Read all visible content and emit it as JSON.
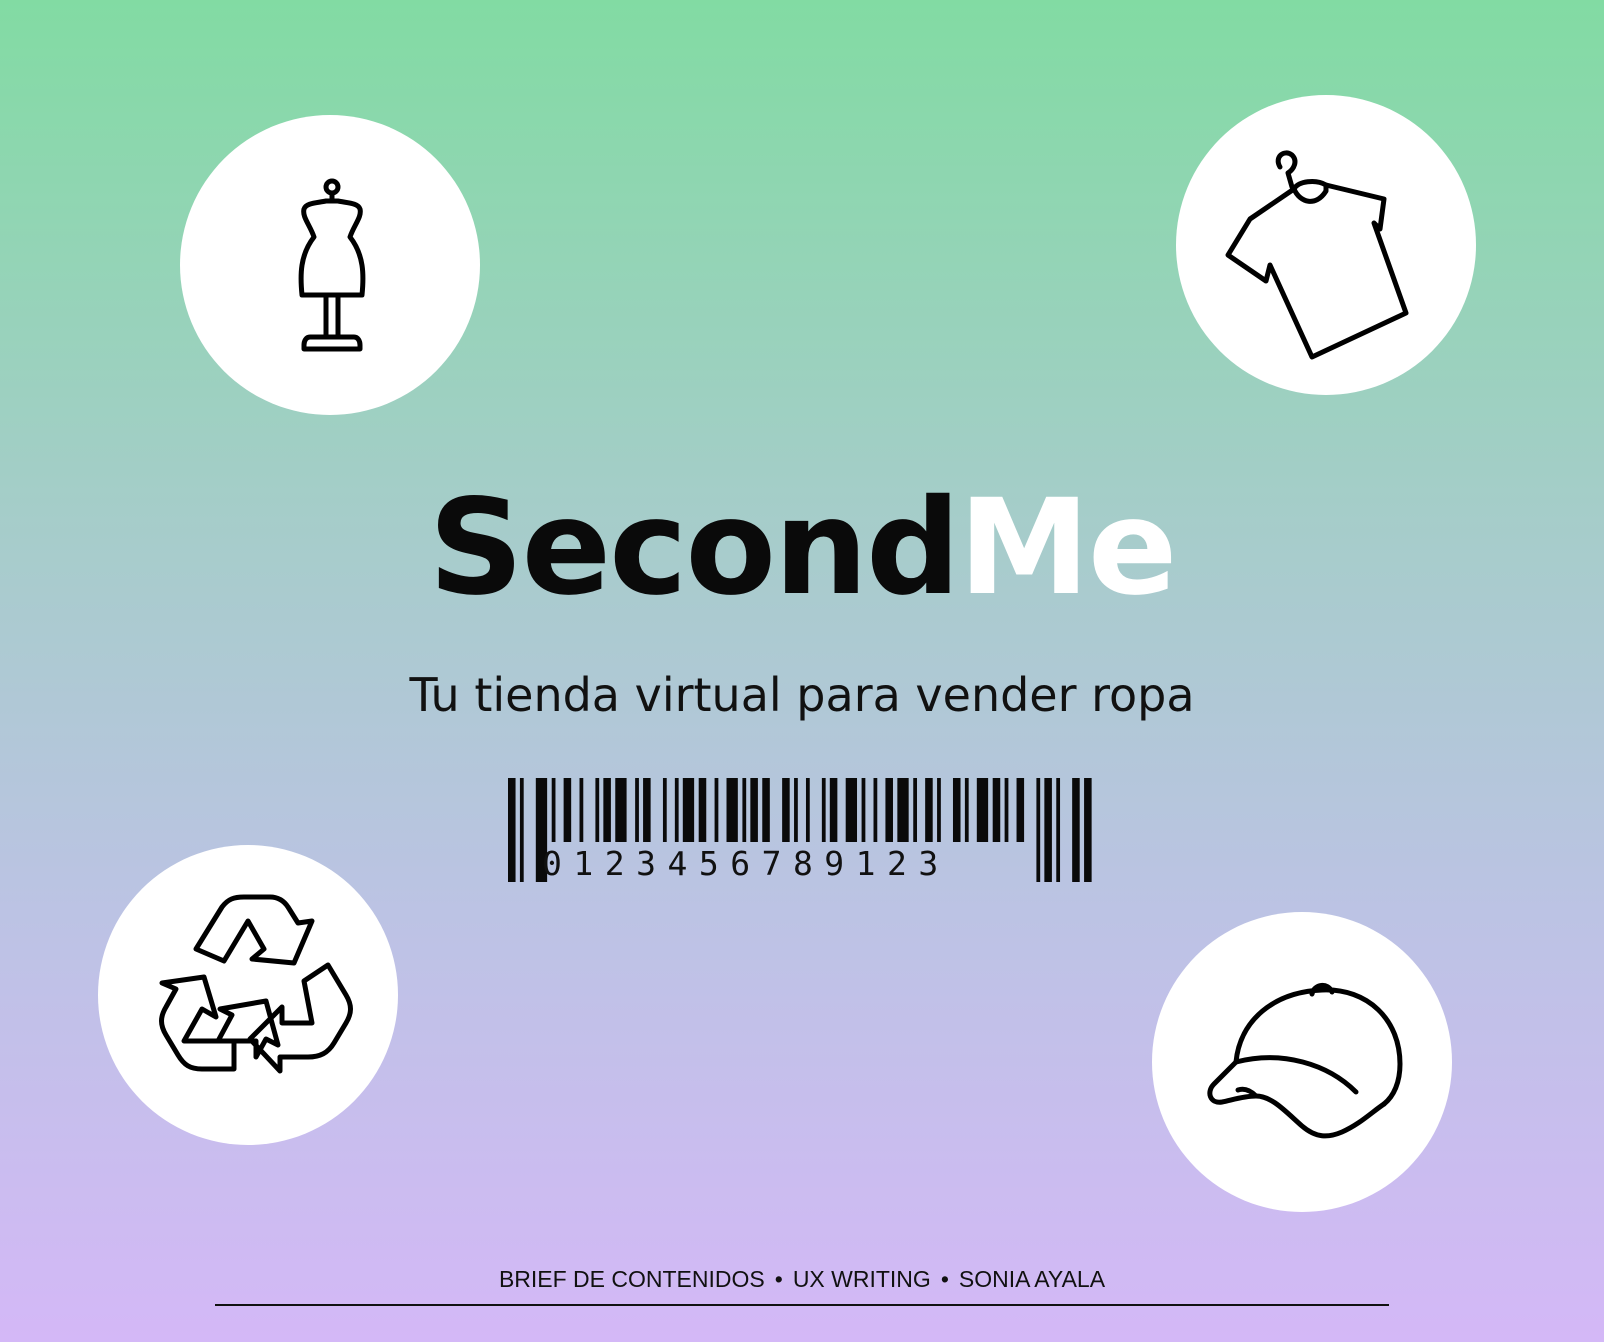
{
  "brand": {
    "part1": "Second",
    "part2": "Me"
  },
  "tagline": "Tu tienda virtual para vender ropa",
  "barcode": {
    "number": "0123456789123"
  },
  "footer": {
    "items": [
      "BRIEF DE CONTENIDOS",
      "UX WRITING",
      "SONIA AYALA"
    ],
    "separator": "•"
  },
  "icons": {
    "top_left": "dress-form-icon",
    "top_right": "shirt-on-hanger-icon",
    "bottom_left": "recycle-icon",
    "bottom_right": "baseball-cap-icon"
  },
  "colors": {
    "gradient_top": "#82dba3",
    "gradient_bottom": "#d4b8f7",
    "brand_dark": "#0a0a0a",
    "brand_light": "#ffffff"
  }
}
